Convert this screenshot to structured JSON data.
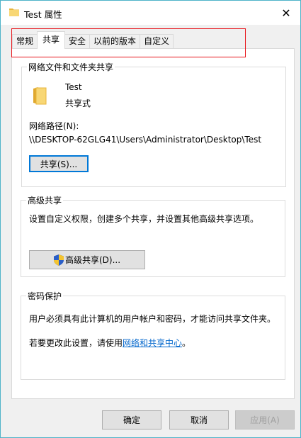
{
  "window": {
    "title": "Test 属性",
    "close_glyph": "✕"
  },
  "tabs": [
    {
      "label": "常规",
      "active": false
    },
    {
      "label": "共享",
      "active": true
    },
    {
      "label": "安全",
      "active": false
    },
    {
      "label": "以前的版本",
      "active": false
    },
    {
      "label": "自定义",
      "active": false
    }
  ],
  "network_share": {
    "group_title": "网络文件和文件夹共享",
    "folder_name": "Test",
    "share_status": "共享式",
    "path_label": "网络路径(N):",
    "path_value": "\\\\DESKTOP-62GLG41\\Users\\Administrator\\Desktop\\Test",
    "share_button": "共享(S)..."
  },
  "advanced_share": {
    "group_title": "高级共享",
    "description": "设置自定义权限，创建多个共享，并设置其他高级共享选项。",
    "button": "高级共享(D)..."
  },
  "password": {
    "group_title": "密码保护",
    "description": "用户必须具有此计算机的用户帐户和密码，才能访问共享文件夹。",
    "change_prefix": "若要更改此设置，请使用",
    "link": "网络和共享中心",
    "change_suffix": "。"
  },
  "footer": {
    "ok": "确定",
    "cancel": "取消",
    "apply": "应用(A)"
  },
  "colors": {
    "highlight_border": "#e8141a",
    "link": "#0066cc",
    "focus": "#0078d7"
  }
}
